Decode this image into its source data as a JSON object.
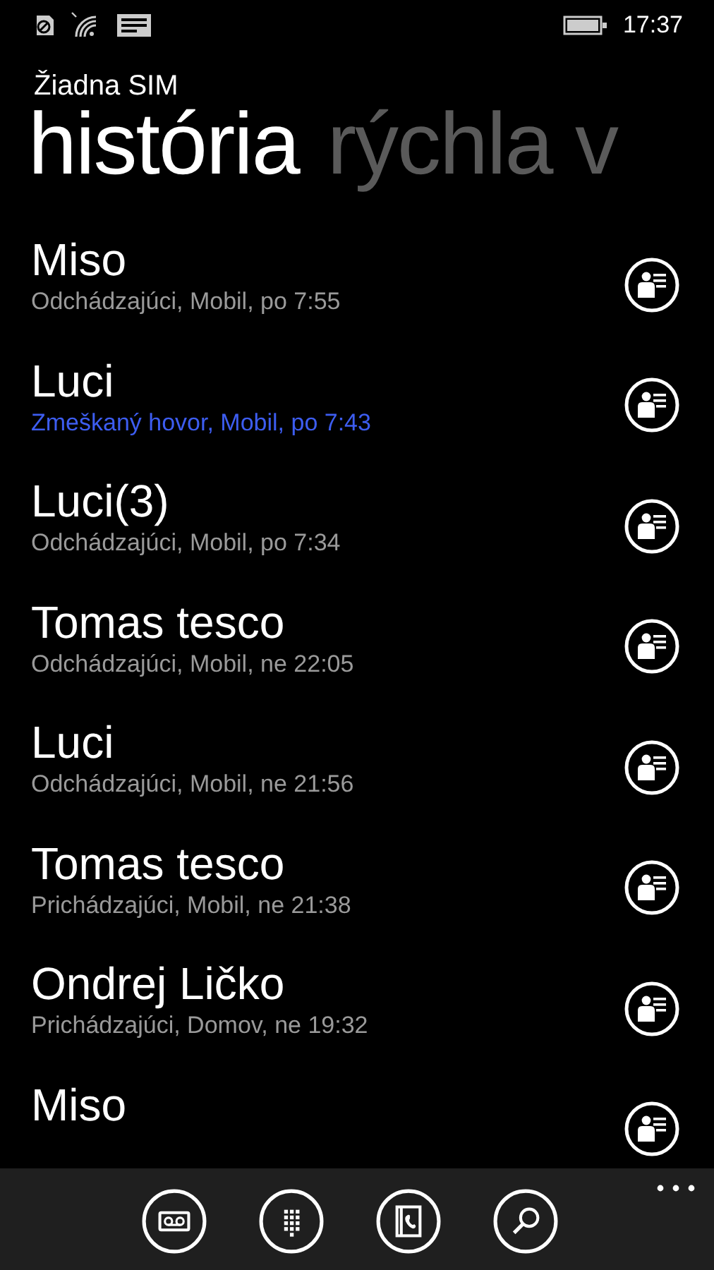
{
  "status_bar": {
    "time": "17:37"
  },
  "carrier": "Žiadna SIM",
  "pivot": [
    {
      "label": "história",
      "selected": true
    },
    {
      "label": "rýchla v",
      "selected": false
    }
  ],
  "calls": [
    {
      "name": "Miso",
      "detail": "Odchádzajúci, Mobil, po 7:55",
      "missed": false
    },
    {
      "name": "Luci",
      "detail": "Zmeškaný hovor, Mobil, po 7:43",
      "missed": true
    },
    {
      "name": "Luci(3)",
      "detail": "Odchádzajúci, Mobil, po 7:34",
      "missed": false
    },
    {
      "name": "Tomas tesco",
      "detail": "Odchádzajúci, Mobil, ne 22:05",
      "missed": false
    },
    {
      "name": "Luci",
      "detail": "Odchádzajúci, Mobil, ne 21:56",
      "missed": false
    },
    {
      "name": "Tomas tesco",
      "detail": "Prichádzajúci, Mobil, ne 21:38",
      "missed": false
    },
    {
      "name": "Ondrej Ličko",
      "detail": "Prichádzajúci, Domov, ne 19:32",
      "missed": false
    },
    {
      "name": "Miso"
    }
  ],
  "app_bar": {
    "buttons": [
      {
        "kind": "voicemail"
      },
      {
        "kind": "keypad"
      },
      {
        "kind": "contacts"
      },
      {
        "kind": "search"
      }
    ]
  }
}
